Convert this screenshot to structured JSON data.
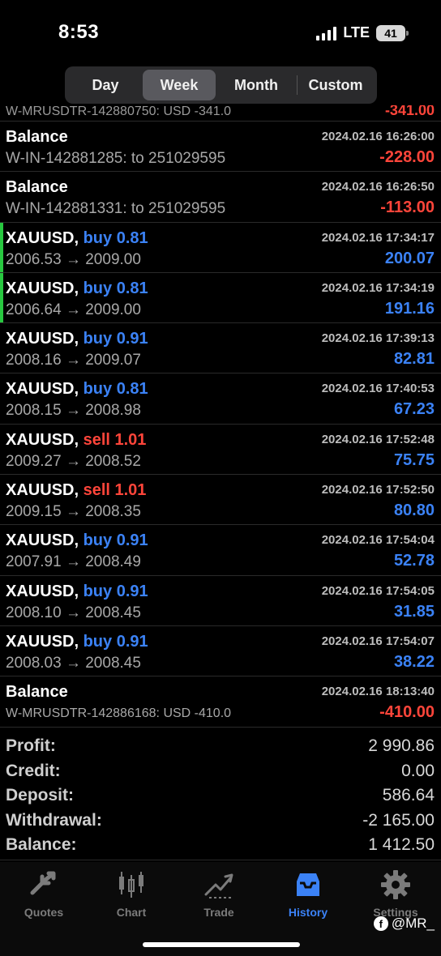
{
  "status": {
    "time": "8:53",
    "network": "LTE",
    "battery": "41"
  },
  "periods": [
    "Day",
    "Week",
    "Month",
    "Custom"
  ],
  "active_period": "Week",
  "peek_row": {
    "text": "W-MRUSDTR-142880750: USD -341.0",
    "amount": "-341.00"
  },
  "rows": [
    {
      "type": "balance",
      "title": "Balance",
      "time": "2024.02.16 16:26:00",
      "sub": "W-IN-142881285: to 251029595",
      "amount": "-228.00"
    },
    {
      "type": "balance",
      "title": "Balance",
      "time": "2024.02.16 16:26:50",
      "sub": "W-IN-142881331: to 251029595",
      "amount": "-113.00"
    },
    {
      "type": "trade",
      "symbol": "XAUUSD,",
      "side": "buy",
      "volume": "buy 0.81",
      "time": "2024.02.16 17:34:17",
      "sub": "2006.53 → 2009.00",
      "amount": "200.07"
    },
    {
      "type": "trade",
      "symbol": "XAUUSD,",
      "side": "buy",
      "volume": "buy 0.81",
      "time": "2024.02.16 17:34:19",
      "sub": "2006.64 → 2009.00",
      "amount": "191.16"
    },
    {
      "type": "trade",
      "symbol": "XAUUSD,",
      "side": "buy",
      "volume": "buy 0.91",
      "time": "2024.02.16 17:39:13",
      "sub": "2008.16 → 2009.07",
      "amount": "82.81"
    },
    {
      "type": "trade",
      "symbol": "XAUUSD,",
      "side": "buy",
      "volume": "buy 0.81",
      "time": "2024.02.16 17:40:53",
      "sub": "2008.15 → 2008.98",
      "amount": "67.23"
    },
    {
      "type": "trade",
      "symbol": "XAUUSD,",
      "side": "sell",
      "volume": "sell 1.01",
      "time": "2024.02.16 17:52:48",
      "sub": "2009.27 → 2008.52",
      "amount": "75.75"
    },
    {
      "type": "trade",
      "symbol": "XAUUSD,",
      "side": "sell",
      "volume": "sell 1.01",
      "time": "2024.02.16 17:52:50",
      "sub": "2009.15 → 2008.35",
      "amount": "80.80"
    },
    {
      "type": "trade",
      "symbol": "XAUUSD,",
      "side": "buy",
      "volume": "buy 0.91",
      "time": "2024.02.16 17:54:04",
      "sub": "2007.91 → 2008.49",
      "amount": "52.78"
    },
    {
      "type": "trade",
      "symbol": "XAUUSD,",
      "side": "buy",
      "volume": "buy 0.91",
      "time": "2024.02.16 17:54:05",
      "sub": "2008.10 → 2008.45",
      "amount": "31.85"
    },
    {
      "type": "trade",
      "symbol": "XAUUSD,",
      "side": "buy",
      "volume": "buy 0.91",
      "time": "2024.02.16 17:54:07",
      "sub": "2008.03 → 2008.45",
      "amount": "38.22"
    },
    {
      "type": "balance",
      "title": "Balance",
      "time": "2024.02.16 18:13:40",
      "sub": "W-MRUSDTR-142886168: USD -410.0",
      "amount": "-410.00"
    }
  ],
  "summary": [
    {
      "label": "Profit:",
      "value": "2 990.86"
    },
    {
      "label": "Credit:",
      "value": "0.00"
    },
    {
      "label": "Deposit:",
      "value": "586.64"
    },
    {
      "label": "Withdrawal:",
      "value": "-2 165.00"
    },
    {
      "label": "Balance:",
      "value": "1 412.50"
    }
  ],
  "tabs": [
    {
      "label": "Quotes",
      "icon": "quotes-icon"
    },
    {
      "label": "Chart",
      "icon": "chart-icon"
    },
    {
      "label": "Trade",
      "icon": "trade-icon"
    },
    {
      "label": "History",
      "icon": "history-icon"
    },
    {
      "label": "Settings",
      "icon": "settings-icon"
    }
  ],
  "active_tab": "History",
  "watermark": "@MR_"
}
